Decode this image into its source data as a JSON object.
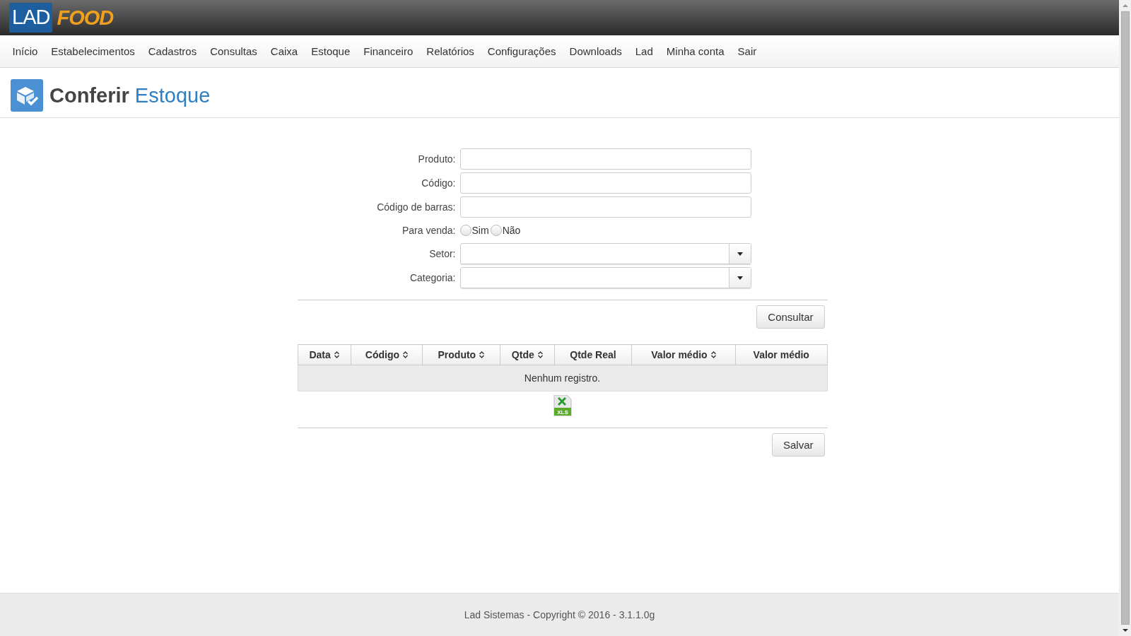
{
  "logo": {
    "part_1": "LAD",
    "part_2": "FOOD"
  },
  "nav": [
    {
      "label": "Início"
    },
    {
      "label": "Estabelecimentos"
    },
    {
      "label": "Cadastros"
    },
    {
      "label": "Consultas"
    },
    {
      "label": "Caixa"
    },
    {
      "label": "Estoque"
    },
    {
      "label": "Financeiro"
    },
    {
      "label": "Relatórios"
    },
    {
      "label": "Configurações"
    },
    {
      "label": "Downloads"
    },
    {
      "label": "Lad"
    },
    {
      "label": "Minha conta"
    },
    {
      "label": "Sair"
    }
  ],
  "page_title": {
    "part_1": "Conferir",
    "part_2": "Estoque"
  },
  "form": [
    {
      "kind": "text",
      "label": "Produto:"
    },
    {
      "kind": "text",
      "label": "Código:"
    },
    {
      "kind": "text",
      "label": "Código de barras:"
    },
    {
      "kind": "radio",
      "label": "Para venda:",
      "options": [
        {
          "label": "Sim",
          "selected": false
        },
        {
          "label": "Não",
          "selected": false
        }
      ]
    },
    {
      "kind": "select",
      "label": "Setor:"
    },
    {
      "kind": "select",
      "label": "Categoria:"
    }
  ],
  "search_button": "Consultar",
  "table": {
    "columns": [
      {
        "label": "Data",
        "sortable": true
      },
      {
        "label": "Código",
        "sortable": true
      },
      {
        "label": "Produto",
        "sortable": true
      },
      {
        "label": "Qtde",
        "sortable": true
      },
      {
        "label": "Qtde Real",
        "sortable": false
      },
      {
        "label": "Valor médio",
        "sortable": true
      },
      {
        "label": "Valor médio",
        "sortable": false
      }
    ],
    "empty_message": "Nenhum registro."
  },
  "export_icon_label": "XLS",
  "save_button": "Salvar",
  "footer": "Lad Sistemas - Copyright © 2016 - 3.1.1.0g"
}
